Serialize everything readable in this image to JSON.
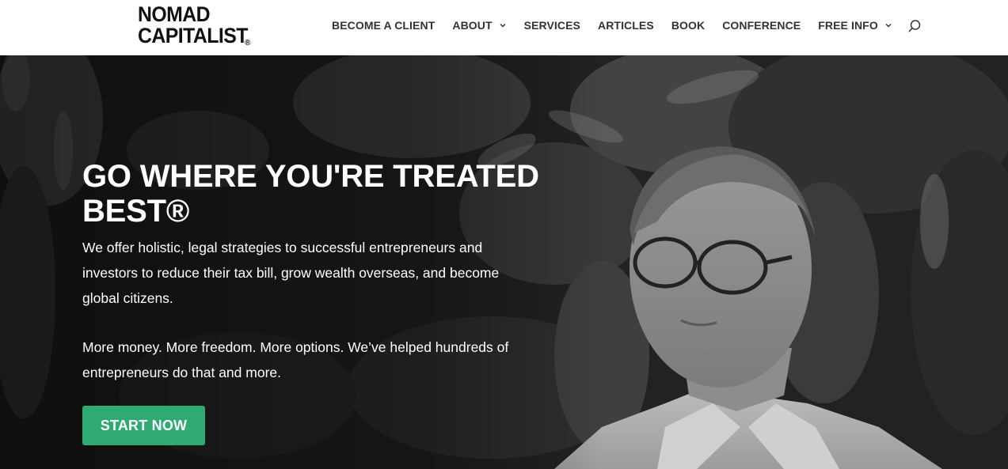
{
  "logo": {
    "line1": "NOMAD",
    "line2": "CAPITALIST",
    "mark": "®"
  },
  "nav": {
    "items": [
      {
        "label": "BECOME A CLIENT",
        "has_dropdown": false
      },
      {
        "label": "ABOUT",
        "has_dropdown": true
      },
      {
        "label": "SERVICES",
        "has_dropdown": false
      },
      {
        "label": "ARTICLES",
        "has_dropdown": false
      },
      {
        "label": "BOOK",
        "has_dropdown": false
      },
      {
        "label": "CONFERENCE",
        "has_dropdown": false
      },
      {
        "label": "FREE INFO",
        "has_dropdown": true
      }
    ],
    "search_icon": "search-icon",
    "dropdown_icon": "chevron-down-icon"
  },
  "hero": {
    "title": "GO WHERE YOU'RE TREATED BEST®",
    "paragraph1": "We offer holistic, legal strategies to successful entrepreneurs and investors to reduce their tax bill, grow wealth overseas, and become global citizens.",
    "paragraph2": "More money. More freedom. More options. We’ve helped hundreds of entrepreneurs do that and more.",
    "cta_label": "START NOW"
  },
  "colors": {
    "accent": "#2eaa72",
    "nav_text": "#333333",
    "hero_text": "#ffffff"
  }
}
